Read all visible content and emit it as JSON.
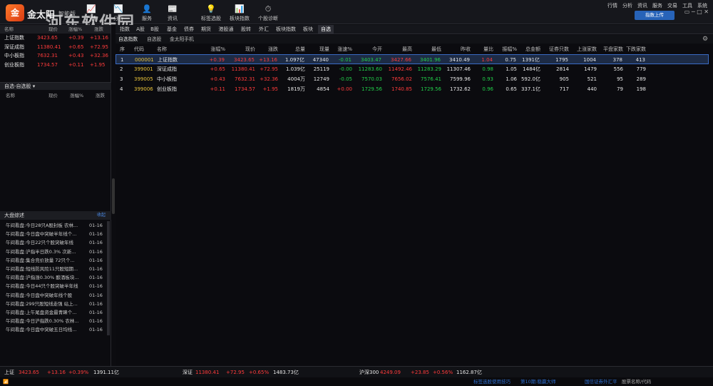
{
  "app": {
    "logo_char": "金",
    "name": "金太阳",
    "sub": "智能版"
  },
  "toolbar": [
    {
      "icon": "line-chart-icon",
      "glyph": "📈",
      "label": "行情"
    },
    {
      "icon": "trend-icon",
      "glyph": "📉",
      "label": "分析"
    },
    {
      "icon": "user-service-icon",
      "glyph": "👤",
      "label": "服务"
    },
    {
      "icon": "news-icon",
      "glyph": "📰",
      "label": "资讯"
    },
    {
      "icon": "tag-select-icon",
      "glyph": "💡",
      "label": "标签选股"
    },
    {
      "icon": "bar-index-icon",
      "glyph": "📊",
      "label": "板块指数"
    },
    {
      "icon": "gauge-icon",
      "glyph": "⏱",
      "label": "个股诊断"
    }
  ],
  "watermark": {
    "main": "河东软件园",
    "url": "www.pc0359.cn"
  },
  "topmenu": [
    "行情",
    "分析",
    "资讯",
    "服务",
    "交易",
    "工具",
    "系统"
  ],
  "upload_label": "指数上传",
  "left_header": {
    "col1": "名称",
    "col2": "现价",
    "col3": "涨幅%",
    "col4": "涨跌"
  },
  "left_indices": [
    {
      "name": "上证指数",
      "price": "3423.65",
      "pct": "+0.39",
      "chg": "+13.16"
    },
    {
      "name": "深证成指",
      "price": "11380.41",
      "pct": "+0.65",
      "chg": "+72.95"
    },
    {
      "name": "中小板指",
      "price": "7632.31",
      "pct": "+0.43",
      "chg": "+32.36"
    },
    {
      "name": "创业板指",
      "price": "1734.57",
      "pct": "+0.11",
      "chg": "+1.95"
    }
  ],
  "zx": {
    "title": "自选-自选股",
    "cols": [
      "名称",
      "现价",
      "涨幅%",
      "涨跌"
    ]
  },
  "news": {
    "title": "大盘综述",
    "more": "收起",
    "items": [
      {
        "t": "午间看盘:今日28只A股封板 农林...",
        "d": "01-16"
      },
      {
        "t": "午间看盘:今日盘中突破半年线个...",
        "d": "01-16"
      },
      {
        "t": "午间看盘:今日22只个股突破年线",
        "d": "01-16"
      },
      {
        "t": "午间看盘:沪指半日跌0.3% 次新...",
        "d": "01-16"
      },
      {
        "t": "午间看盘:集合竞价放量 72只个...",
        "d": "01-16"
      },
      {
        "t": "午间看盘:短线防风险11只股短期...",
        "d": "01-16"
      },
      {
        "t": "午间看盘:沪指涨0.30% 酿酒板块...",
        "d": "01-16"
      },
      {
        "t": "午间看盘:今日44只个股突破半年线",
        "d": "01-16"
      },
      {
        "t": "午间看盘:今日盘中突破年线个股",
        "d": "01-16"
      },
      {
        "t": "午间看盘:299只股短线走强 站上...",
        "d": "01-16"
      },
      {
        "t": "午间看盘:上午尾盘资金最青睐个...",
        "d": "01-16"
      },
      {
        "t": "午间看盘:今日沪指跌0.30% 农林...",
        "d": "01-16"
      },
      {
        "t": "午间看盘:今日盘中突破五日均线...",
        "d": "01-16"
      }
    ]
  },
  "tabs1": [
    "指数",
    "A股",
    "B股",
    "基金",
    "债券",
    "期货",
    "港股通",
    "股转",
    "外汇",
    "板块指数",
    "板块",
    "自选"
  ],
  "tabs2": [
    "自选指数",
    "自选股",
    "金太阳手机"
  ],
  "table": {
    "headers": [
      "序",
      "代码",
      "名称",
      "涨幅%",
      "现价",
      "涨跌",
      "总量",
      "现量",
      "涨速%",
      "今开",
      "最高",
      "最低",
      "昨收",
      "量比",
      "振幅%",
      "总金额",
      "证券只数",
      "上涨家数",
      "平盘家数",
      "下跌家数"
    ],
    "rows": [
      [
        "1",
        "000001",
        "上证指数",
        "+0.39",
        "3423.65",
        "+13.16",
        "1.097亿",
        "47340",
        "-0.01",
        "3403.47",
        "3427.66",
        "3401.96",
        "3410.49",
        "1.04",
        "0.75",
        "1391亿",
        "1795",
        "1004",
        "378",
        "413"
      ],
      [
        "2",
        "399001",
        "深证成指",
        "+0.65",
        "11380.41",
        "+72.95",
        "1.039亿",
        "25119",
        "-0.00",
        "11283.60",
        "11492.46",
        "11283.29",
        "11307.46",
        "0.98",
        "1.05",
        "1484亿",
        "2814",
        "1479",
        "556",
        "779"
      ],
      [
        "3",
        "399005",
        "中小板指",
        "+0.43",
        "7632.31",
        "+32.36",
        "4004万",
        "12749",
        "-0.05",
        "7570.03",
        "7656.02",
        "7576.41",
        "7599.96",
        "0.93",
        "1.06",
        "592.0亿",
        "905",
        "521",
        "95",
        "289"
      ],
      [
        "4",
        "399006",
        "创业板指",
        "+0.11",
        "1734.57",
        "+1.95",
        "1819万",
        "4854",
        "+0.00",
        "1729.56",
        "1740.85",
        "1729.56",
        "1732.62",
        "0.96",
        "0.65",
        "337.1亿",
        "717",
        "440",
        "79",
        "198"
      ]
    ]
  },
  "bottom": {
    "sh": {
      "name": "上证",
      "price": "3423.65",
      "chg": "+13.16",
      "pct": "+0.39%",
      "amt": "1391.11亿"
    },
    "sz": {
      "name": "深证",
      "price": "11380.41",
      "chg": "+72.95",
      "pct": "+0.65%",
      "amt": "1483.73亿"
    },
    "hs": {
      "name": "沪深300",
      "price": "4249.09",
      "chg": "+23.85",
      "pct": "+0.56%",
      "amt": "1162.87亿"
    }
  },
  "status": {
    "a": "标签选股使用技巧",
    "b": "第10期:稳赢大师",
    "c": "国信证券外汇平",
    "d": "股票名称/代码"
  }
}
